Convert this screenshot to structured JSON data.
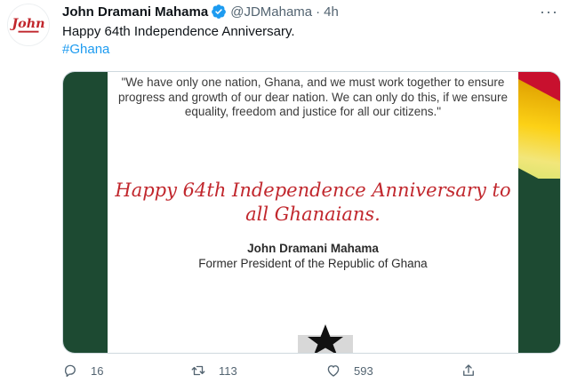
{
  "tweet": {
    "author_name": "John Dramani Mahama",
    "handle": "@JDMahama",
    "separator": "·",
    "time": "4h",
    "text": "Happy 64th Independence Anniversary.",
    "hashtag": "#Ghana",
    "more_label": "···"
  },
  "media": {
    "quote": "\"We have only one nation, Ghana, and we must work together to ensure progress and growth of our dear nation. We can only do this, if we ensure equality, freedom and justice for all our citizens.\"",
    "greeting": "Happy 64th Independence Anniversary to all Ghanaians.",
    "signature_name": "John Dramani Mahama",
    "signature_title": "Former President of the Republic of Ghana"
  },
  "actions": {
    "replies": "16",
    "retweets": "113",
    "likes": "593"
  },
  "colors": {
    "accent": "#1d9bf0",
    "ghana_green": "#1d4a32",
    "ghana_red": "#c1272d",
    "ghana_gold": "#fcd116"
  },
  "icons": {
    "avatar": "john-logo-icon",
    "verified": "verified-badge-icon",
    "reply": "reply-icon",
    "retweet": "retweet-icon",
    "like": "heart-icon",
    "share": "share-icon",
    "star": "black-star-icon"
  }
}
